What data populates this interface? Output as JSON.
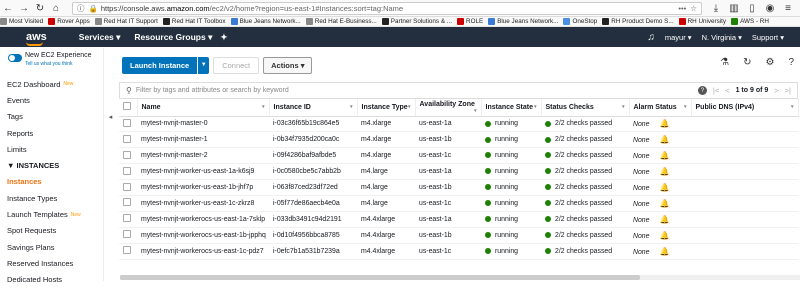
{
  "browser": {
    "url_prefix": "https://console.aws.",
    "url_host": "amazon.com",
    "url_rest": "/ec2/v2/home?region=us-east-1#Instances:sort=tag:Name",
    "more": "•••"
  },
  "bookmarks": [
    {
      "label": "Most Visited",
      "color": "#888888"
    },
    {
      "label": "Rover Apps",
      "color": "#cc0000"
    },
    {
      "label": "Red Hat IT Support",
      "color": "#888888"
    },
    {
      "label": "Red Hat IT Toolbox",
      "color": "#222222"
    },
    {
      "label": "Blue Jeans Network...",
      "color": "#3a7bd5"
    },
    {
      "label": "Red Hat E-Business...",
      "color": "#888888"
    },
    {
      "label": "Partner Solutions & ...",
      "color": "#222222"
    },
    {
      "label": "ROLE",
      "color": "#cc0000"
    },
    {
      "label": "Blue Jeans Network...",
      "color": "#3a7bd5"
    },
    {
      "label": "OneStop",
      "color": "#4a90e2"
    },
    {
      "label": "RH Product Demo S...",
      "color": "#222222"
    },
    {
      "label": "RH University",
      "color": "#cc0000"
    },
    {
      "label": "AWS - RH",
      "color": "#1d8102"
    }
  ],
  "aws": {
    "logo": "aws",
    "services": "Services ▾",
    "resource_groups": "Resource Groups ▾",
    "pin": "✦",
    "user": "mayur ▾",
    "region": "N. Virginia ▾",
    "support": "Support ▾"
  },
  "sidebar": {
    "toggle_title": "New EC2 Experience",
    "toggle_sub": "Tell us what you think",
    "dashboard": "EC2 Dashboard",
    "new_badge": "New",
    "items_top": [
      "Events",
      "Tags",
      "Reports",
      "Limits"
    ],
    "section": "▼ INSTANCES",
    "active": "Instances",
    "items_bottom": [
      "Instance Types",
      "Launch Templates",
      "Spot Requests",
      "Savings Plans",
      "Reserved Instances",
      "Dedicated Hosts"
    ]
  },
  "toolbar": {
    "launch": "Launch Instance",
    "connect": "Connect",
    "actions": "Actions ▾"
  },
  "filter": {
    "placeholder": "Filter by tags and attributes or search by keyword",
    "count": "1 to 9 of 9"
  },
  "table": {
    "headers": [
      "Name",
      "Instance ID",
      "Instance Type",
      "Availability Zone",
      "Instance State",
      "Status Checks",
      "Alarm Status",
      "Public DNS (IPv4)"
    ],
    "rows": [
      {
        "name": "mytest-nvnjt-master-0",
        "id": "i-03c36f65b19c864e5",
        "type": "m4.xlarge",
        "az": "us-east-1a",
        "state": "running",
        "checks": "2/2 checks passed",
        "alarm": "None"
      },
      {
        "name": "mytest-nvnjt-master-1",
        "id": "i-0b34f7935d200ca0c",
        "type": "m4.xlarge",
        "az": "us-east-1b",
        "state": "running",
        "checks": "2/2 checks passed",
        "alarm": "None"
      },
      {
        "name": "mytest-nvnjt-master-2",
        "id": "i-09f4286baf9afbde5",
        "type": "m4.xlarge",
        "az": "us-east-1c",
        "state": "running",
        "checks": "2/2 checks passed",
        "alarm": "None"
      },
      {
        "name": "mytest-nvnjt-worker-us-east-1a-k6sj9",
        "id": "i-0c0580cbe5c7abb2b",
        "type": "m4.large",
        "az": "us-east-1a",
        "state": "running",
        "checks": "2/2 checks passed",
        "alarm": "None"
      },
      {
        "name": "mytest-nvnjt-worker-us-east-1b-jhf7p",
        "id": "i-063f87ced23df72ed",
        "type": "m4.large",
        "az": "us-east-1b",
        "state": "running",
        "checks": "2/2 checks passed",
        "alarm": "None"
      },
      {
        "name": "mytest-nvnjt-worker-us-east-1c-zkrz8",
        "id": "i-05f77de86aecb4e0a",
        "type": "m4.large",
        "az": "us-east-1c",
        "state": "running",
        "checks": "2/2 checks passed",
        "alarm": "None"
      },
      {
        "name": "mytest-nvnjt-workerocs-us-east-1a-7sklp",
        "id": "i-033db3491c94d2191",
        "type": "m4.4xlarge",
        "az": "us-east-1a",
        "state": "running",
        "checks": "2/2 checks passed",
        "alarm": "None"
      },
      {
        "name": "mytest-nvnjt-workerocs-us-east-1b-jpphq",
        "id": "i-0d10f4956bbca8785",
        "type": "m4.4xlarge",
        "az": "us-east-1b",
        "state": "running",
        "checks": "2/2 checks passed",
        "alarm": "None"
      },
      {
        "name": "mytest-nvnjt-workerocs-us-east-1c-pdz7",
        "id": "i-0efc7b1a531b7239a",
        "type": "m4.4xlarge",
        "az": "us-east-1c",
        "state": "running",
        "checks": "2/2 checks passed",
        "alarm": "None"
      }
    ]
  },
  "colors": {
    "aws_nav": "#232f3e",
    "primary": "#0073bb",
    "accent": "#ec7211",
    "running": "#1d8102"
  }
}
